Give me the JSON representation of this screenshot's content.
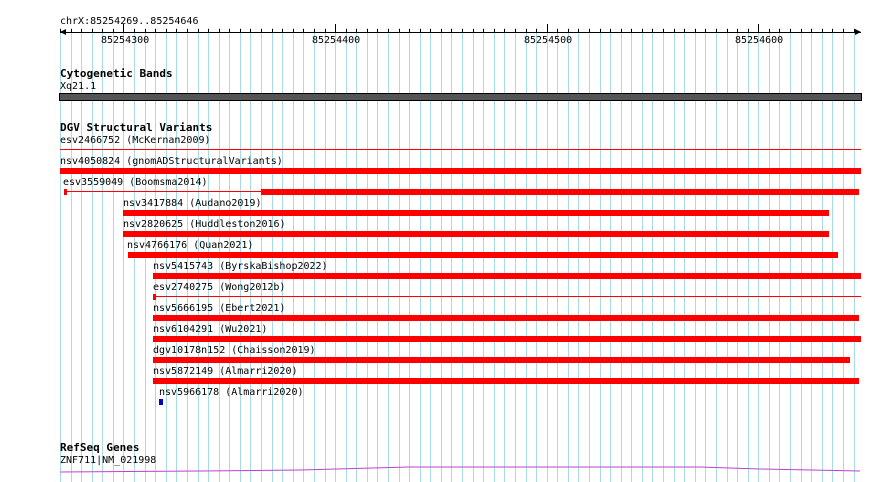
{
  "ruler": {
    "position": "chrX:85254269..85254646",
    "ticks": [
      "85254300",
      "85254400",
      "85254500",
      "85254600"
    ]
  },
  "tracks": {
    "cytoband": {
      "title": "Cytogenetic Bands",
      "band": "Xq21.1"
    },
    "dgv": {
      "title": "DGV Structural Variants",
      "items": [
        {
          "label": "esv2466752 (McKernan2009)"
        },
        {
          "label": "nsv4050824 (gnomADStructuralVariants)"
        },
        {
          "label": "esv3559049 (Boomsma2014)"
        },
        {
          "label": "nsv3417884 (Audano2019)"
        },
        {
          "label": "nsv2820625 (Huddleston2016)"
        },
        {
          "label": "nsv4766176 (Quan2021)"
        },
        {
          "label": "nsv5415743 (ByrskaBishop2022)"
        },
        {
          "label": "esv2740275 (Wong2012b)"
        },
        {
          "label": "nsv5666195 (Ebert2021)"
        },
        {
          "label": "nsv6104291 (Wu2021)"
        },
        {
          "label": "dgv10178n152 (Chaisson2019)"
        },
        {
          "label": "nsv5872149 (Almarri2020)"
        },
        {
          "label": "nsv5966178 (Almarri2020)"
        }
      ]
    },
    "refseq": {
      "title": "RefSeq Genes",
      "gene": "ZNF711|NM_021998"
    }
  },
  "colors": {
    "variant_red": "#ff0000",
    "variant_blue": "#0000cc",
    "cytoband_gray": "#555555",
    "gene_magenta": "#bb44cc",
    "grid": "#a9dbe6"
  }
}
